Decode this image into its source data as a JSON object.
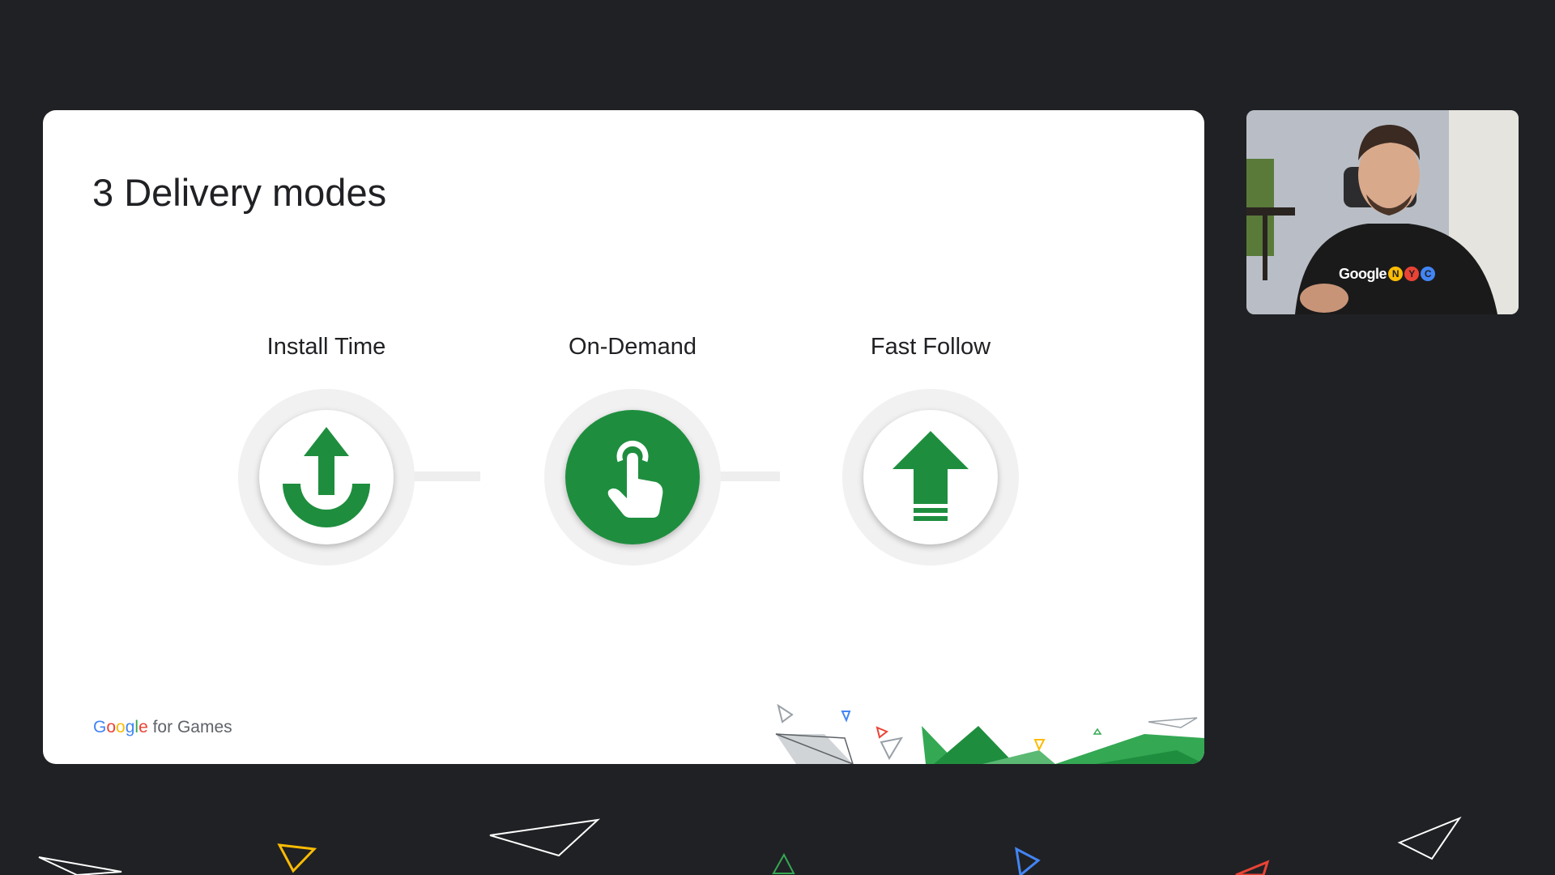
{
  "slide": {
    "title": "3 Delivery modes",
    "modes": [
      {
        "label": "Install Time",
        "icon": "install-arrow-icon"
      },
      {
        "label": "On-Demand",
        "icon": "tap-hand-icon"
      },
      {
        "label": "Fast Follow",
        "icon": "up-arrow-icon"
      }
    ],
    "branding": {
      "google_letters": [
        "G",
        "o",
        "o",
        "g",
        "l",
        "e"
      ],
      "suffix": " for Games"
    }
  },
  "webcam": {
    "shirt_word": "Google",
    "shirt_badges": [
      "N",
      "Y",
      "C"
    ]
  },
  "colors": {
    "background": "#202124",
    "slide": "#ffffff",
    "accent_green": "#1e8e3e",
    "google_blue": "#4285f4",
    "google_red": "#ea4335",
    "google_yellow": "#fbbc04",
    "google_green": "#34a853"
  }
}
